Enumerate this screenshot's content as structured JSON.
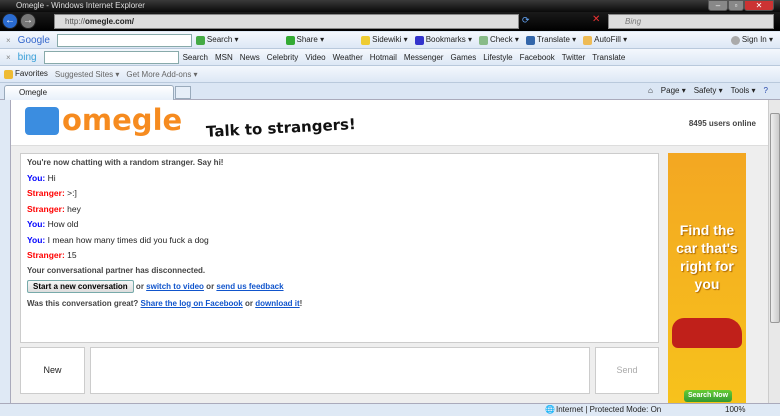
{
  "window": {
    "title": "Omegle - Windows Internet Explorer",
    "url_prefix": "http://",
    "url_domain": "omegle.com/",
    "search_placeholder": "Bing"
  },
  "google_toolbar": {
    "logo": "Google",
    "items": [
      "Search ▾",
      "Share ▾",
      "Sidewiki ▾",
      "Bookmarks ▾",
      "Check ▾",
      "Translate ▾",
      "AutoFill ▾"
    ],
    "sign_in": "Sign In ▾"
  },
  "bing_toolbar": {
    "logo": "bing",
    "items": [
      "Search",
      "MSN",
      "News",
      "Celebrity",
      "Video",
      "Weather",
      "Hotmail",
      "Messenger",
      "Games",
      "Lifestyle",
      "Facebook",
      "Twitter",
      "Translate"
    ]
  },
  "favorites": {
    "label": "Favorites",
    "items": [
      "Suggested Sites ▾",
      "Get More Add-ons ▾"
    ]
  },
  "tab": {
    "label": "Omegle"
  },
  "command_bar": [
    "Page ▾",
    "Safety ▾",
    "Tools ▾"
  ],
  "header": {
    "logo": "omegle",
    "tagline": "Talk to strangers!",
    "users_online": "8495 users online"
  },
  "chat": {
    "intro": "You're now chatting with a random stranger. Say hi!",
    "messages": [
      {
        "who": "You:",
        "text": "Hi"
      },
      {
        "who": "Stranger:",
        "text": ">:]"
      },
      {
        "who": "Stranger:",
        "text": "hey"
      },
      {
        "who": "You:",
        "text": "How old"
      },
      {
        "who": "You:",
        "text": "I mean how many times did you fuck a dog"
      },
      {
        "who": "Stranger:",
        "text": "15"
      }
    ],
    "disconnected": "Your conversational partner has disconnected.",
    "new_conv_button": "Start a new conversation",
    "or1": " or ",
    "switch_video": "switch to video",
    "or2": " or ",
    "feedback": "send us feedback",
    "great_q": "Was this conversation great? ",
    "share_fb": "Share the log on Facebook",
    "or3": " or ",
    "download": "download it",
    "bang": "!"
  },
  "controls": {
    "new": "New",
    "send": "Send"
  },
  "ad": {
    "text": "Find the car that's right for you",
    "button": "Search Now"
  },
  "status": {
    "zone": "Internet | Protected Mode: On",
    "zoom": "100%"
  }
}
